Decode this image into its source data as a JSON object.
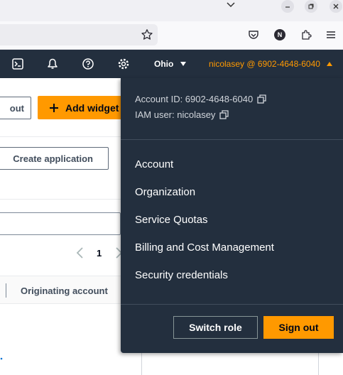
{
  "browser": {
    "window_controls": [
      "minimize-icon",
      "restore-icon",
      "close-icon"
    ],
    "toolbar_icons": [
      "bookmark-star-icon",
      "pocket-icon",
      "profile-icon",
      "extensions-icon",
      "menu-icon"
    ],
    "profile_initial": "N"
  },
  "aws_header": {
    "icons": [
      "cloudshell-icon",
      "notifications-icon",
      "help-icon",
      "settings-icon"
    ],
    "region": "Ohio",
    "account_label": "nicolasey @ 6902-4648-6040"
  },
  "page": {
    "partial_button": "out",
    "add_widget": "Add widget",
    "create_application": "Create application",
    "page_number": "1",
    "column_header": "Originating account"
  },
  "dropdown": {
    "account_id": "Account ID: 6902-4648-6040",
    "iam_user": "IAM user: nicolasey",
    "menu_items": [
      {
        "label": "Account"
      },
      {
        "label": "Organization"
      },
      {
        "label": "Service Quotas"
      },
      {
        "label": "Billing and Cost Management"
      },
      {
        "label": "Security credentials"
      }
    ],
    "switch_role": "Switch role",
    "sign_out": "Sign out"
  },
  "colors": {
    "header_bg": "#232f3e",
    "accent": "#ff9900"
  }
}
